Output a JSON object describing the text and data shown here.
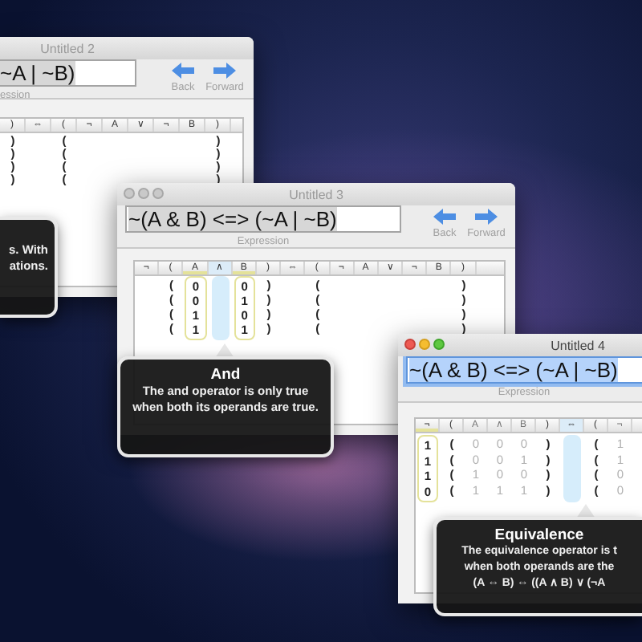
{
  "windows": [
    {
      "title": "Untitled 2",
      "active": false,
      "expression": "~A | ~B)",
      "expression_label": "ession",
      "nav": [
        "Back",
        "Forward"
      ],
      "table": {
        "columns": [
          {
            "label": ")",
            "operand": false,
            "selected": false,
            "dimmed": false
          },
          {
            "label": "⇔",
            "operand": false,
            "selected": false,
            "dimmed": false
          },
          {
            "label": "(",
            "operand": false,
            "selected": false,
            "dimmed": false
          },
          {
            "label": "¬",
            "operand": false,
            "selected": false,
            "dimmed": false
          },
          {
            "label": "A",
            "operand": false,
            "selected": false,
            "dimmed": false
          },
          {
            "label": "∨",
            "operand": false,
            "selected": false,
            "dimmed": false
          },
          {
            "label": "¬",
            "operand": false,
            "selected": false,
            "dimmed": false
          },
          {
            "label": "B",
            "operand": false,
            "selected": false,
            "dimmed": false
          },
          {
            "label": ")",
            "operand": false,
            "selected": false,
            "dimmed": false
          }
        ],
        "rows": [
          [
            ")",
            null,
            "(",
            null,
            null,
            null,
            null,
            null,
            ")"
          ],
          [
            ")",
            null,
            "(",
            null,
            null,
            null,
            null,
            null,
            ")"
          ],
          [
            ")",
            null,
            "(",
            null,
            null,
            null,
            null,
            null,
            ")"
          ],
          [
            ")",
            null,
            "(",
            null,
            null,
            null,
            null,
            null,
            ")"
          ]
        ]
      },
      "tooltip": {
        "lines": [
          "s. With",
          "ations."
        ]
      }
    },
    {
      "title": "Untitled 3",
      "active": false,
      "expression": "~(A & B) <=> (~A | ~B)",
      "expression_label": "Expression",
      "nav": [
        "Back",
        "Forward"
      ],
      "table": {
        "columns": [
          {
            "label": "¬",
            "operand": false,
            "selected": false,
            "dimmed": false
          },
          {
            "label": "(",
            "operand": false,
            "selected": false,
            "dimmed": false
          },
          {
            "label": "A",
            "operand": true,
            "selected": false,
            "dimmed": false
          },
          {
            "label": "∧",
            "operand": false,
            "selected": true,
            "dimmed": false
          },
          {
            "label": "B",
            "operand": true,
            "selected": false,
            "dimmed": false
          },
          {
            "label": ")",
            "operand": false,
            "selected": false,
            "dimmed": false
          },
          {
            "label": "⇔",
            "operand": false,
            "selected": false,
            "dimmed": false
          },
          {
            "label": "(",
            "operand": false,
            "selected": false,
            "dimmed": false
          },
          {
            "label": "¬",
            "operand": false,
            "selected": false,
            "dimmed": false
          },
          {
            "label": "A",
            "operand": false,
            "selected": false,
            "dimmed": false
          },
          {
            "label": "∨",
            "operand": false,
            "selected": false,
            "dimmed": false
          },
          {
            "label": "¬",
            "operand": false,
            "selected": false,
            "dimmed": false
          },
          {
            "label": "B",
            "operand": false,
            "selected": false,
            "dimmed": false
          },
          {
            "label": ")",
            "operand": false,
            "selected": false,
            "dimmed": false
          }
        ],
        "rows": [
          [
            null,
            "(",
            "0",
            null,
            "0",
            ")",
            null,
            "(",
            null,
            null,
            null,
            null,
            null,
            ")"
          ],
          [
            null,
            "(",
            "0",
            null,
            "1",
            ")",
            null,
            "(",
            null,
            null,
            null,
            null,
            null,
            ")"
          ],
          [
            null,
            "(",
            "1",
            null,
            "0",
            ")",
            null,
            "(",
            null,
            null,
            null,
            null,
            null,
            ")"
          ],
          [
            null,
            "(",
            "1",
            null,
            "1",
            ")",
            null,
            "(",
            null,
            null,
            null,
            null,
            null,
            ")"
          ]
        ]
      },
      "tooltip": {
        "title": "And",
        "lines": [
          "The **and** operator is only true when both its operands are true."
        ]
      }
    },
    {
      "title": "Untitled 4",
      "active": true,
      "expression": "~(A & B) <=> (~A | ~B)",
      "expression_label": "Expression",
      "table": {
        "columns": [
          {
            "label": "¬",
            "operand": true,
            "selected": false,
            "dimmed": false
          },
          {
            "label": "(",
            "operand": false,
            "selected": false,
            "dimmed": false
          },
          {
            "label": "A",
            "operand": false,
            "selected": false,
            "dimmed": true
          },
          {
            "label": "∧",
            "operand": false,
            "selected": false,
            "dimmed": true
          },
          {
            "label": "B",
            "operand": false,
            "selected": false,
            "dimmed": true
          },
          {
            "label": ")",
            "operand": false,
            "selected": false,
            "dimmed": false
          },
          {
            "label": "⇔",
            "operand": false,
            "selected": true,
            "dimmed": false
          },
          {
            "label": "(",
            "operand": false,
            "selected": false,
            "dimmed": false
          },
          {
            "label": "¬",
            "operand": false,
            "selected": false,
            "dimmed": true
          }
        ],
        "rows": [
          [
            "1",
            "(",
            "0",
            "0",
            "0",
            ")",
            null,
            "(",
            "1"
          ],
          [
            "1",
            "(",
            "0",
            "0",
            "1",
            ")",
            null,
            "(",
            "1"
          ],
          [
            "1",
            "(",
            "1",
            "0",
            "0",
            ")",
            null,
            "(",
            "0"
          ],
          [
            "0",
            "(",
            "1",
            "1",
            "1",
            ")",
            null,
            "(",
            "0"
          ]
        ]
      },
      "tooltip": {
        "title": "Equivalence",
        "lines": [
          "The **equivalence** operator is t",
          "when both operands are the",
          "(A ⇔ B) ⇔ ((A ∧ B) ∨ (¬A"
        ]
      }
    }
  ]
}
